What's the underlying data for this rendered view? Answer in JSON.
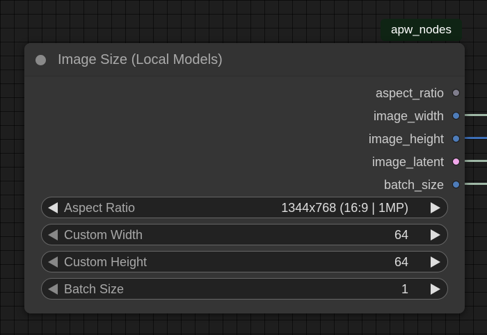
{
  "badge": {
    "label": "apw_nodes",
    "color": "#0f2414"
  },
  "node": {
    "title": "Image Size (Local Models)",
    "outputs": [
      {
        "label": "aspect_ratio",
        "slot_color": "#7f7d8c",
        "connected": false,
        "link_color": ""
      },
      {
        "label": "image_width",
        "slot_color": "#4e7cb9",
        "connected": true,
        "link_color": "#9fb8a6"
      },
      {
        "label": "image_height",
        "slot_color": "#4e7cb9",
        "connected": true,
        "link_color": "#3d6fb8"
      },
      {
        "label": "image_latent",
        "slot_color": "#f0a8ea",
        "connected": true,
        "link_color": "#9fb8a6"
      },
      {
        "label": "batch_size",
        "slot_color": "#4e7cb9",
        "connected": true,
        "link_color": "#9fb8a6"
      }
    ],
    "widgets": [
      {
        "label": "Aspect Ratio",
        "value": "1344x768 (16:9 | 1MP)",
        "left_enabled": true
      },
      {
        "label": "Custom Width",
        "value": "64",
        "left_enabled": false
      },
      {
        "label": "Custom Height",
        "value": "64",
        "left_enabled": false
      },
      {
        "label": "Batch Size",
        "value": "1",
        "left_enabled": false
      }
    ]
  }
}
